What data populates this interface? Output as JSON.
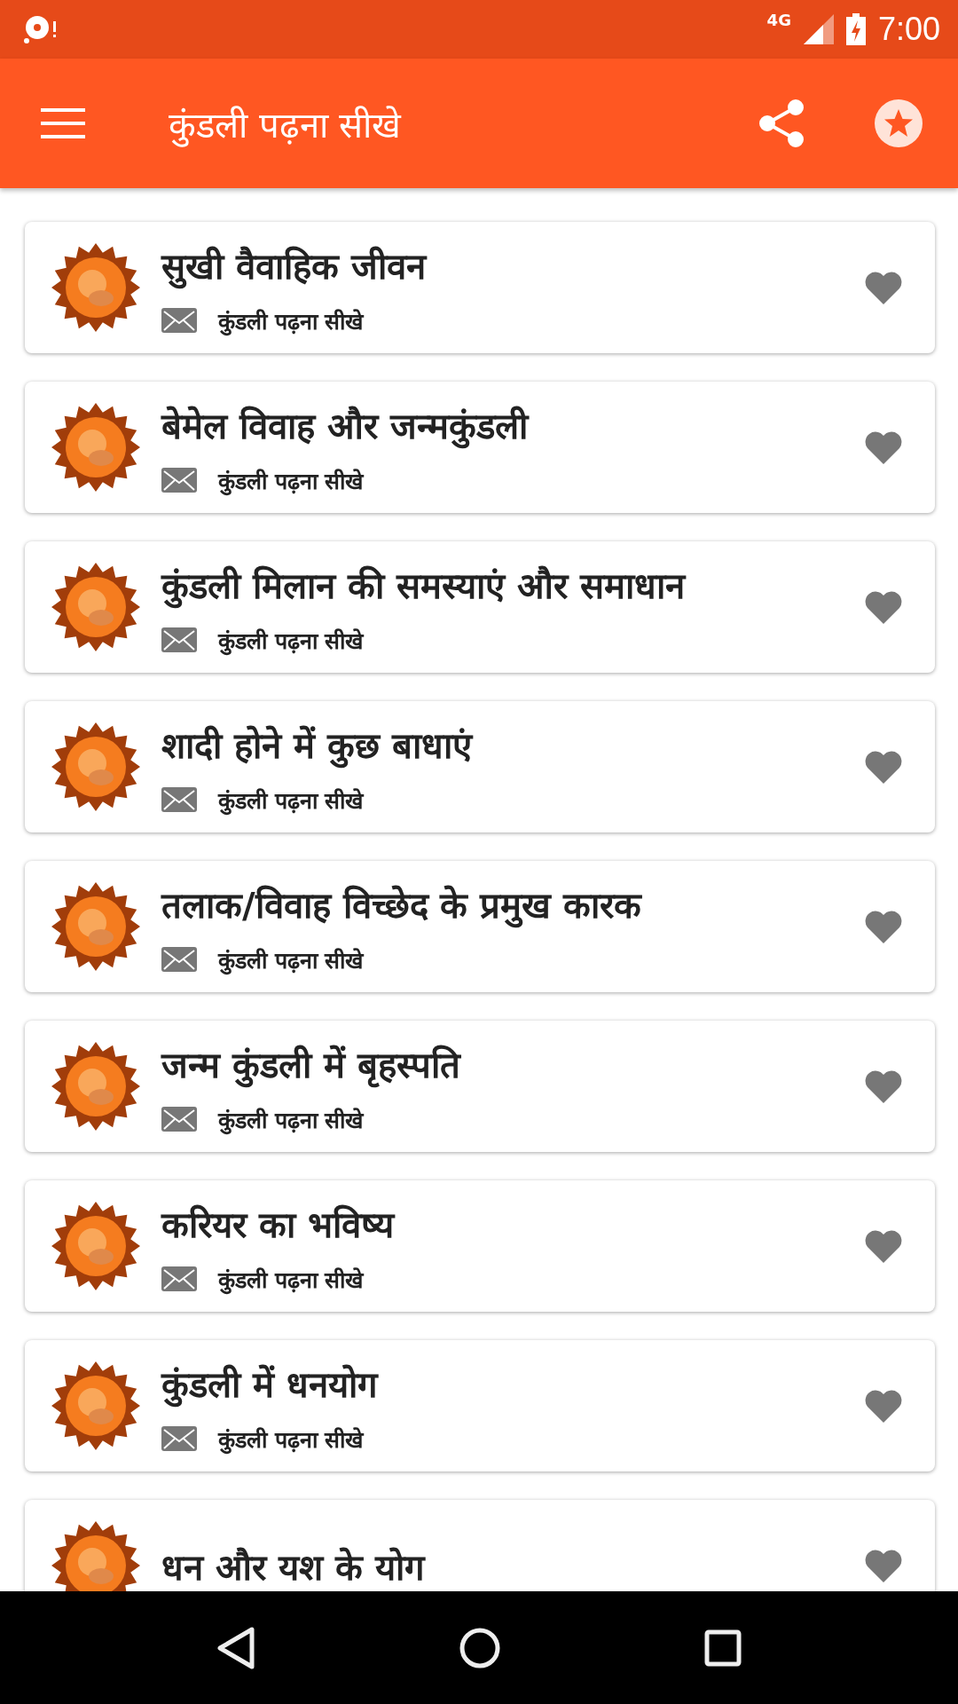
{
  "status_bar": {
    "network": "4G",
    "time": "7:00"
  },
  "toolbar": {
    "title": "कुंडली पढ़ना सीखे"
  },
  "articles": [
    {
      "title": "सुखी वैवाहिक जीवन",
      "subtitle": "कुंडली पढ़ना सीखे"
    },
    {
      "title": "बेमेल विवाह और जन्मकुंडली",
      "subtitle": "कुंडली पढ़ना सीखे"
    },
    {
      "title": "कुंडली मिलान की समस्याएं और समाधान",
      "subtitle": "कुंडली पढ़ना सीखे"
    },
    {
      "title": "शादी होने में कुछ बाधाएं",
      "subtitle": "कुंडली पढ़ना सीखे"
    },
    {
      "title": "तलाक/विवाह विच्छेद के प्रमुख कारक",
      "subtitle": "कुंडली पढ़ना सीखे"
    },
    {
      "title": "जन्म कुंडली में बृहस्पति",
      "subtitle": "कुंडली पढ़ना सीखे"
    },
    {
      "title": "करियर का भविष्य",
      "subtitle": "कुंडली पढ़ना सीखे"
    },
    {
      "title": "कुंडली में धनयोग",
      "subtitle": "कुंडली पढ़ना सीखे"
    },
    {
      "title": "धन और यश के योग"
    }
  ]
}
